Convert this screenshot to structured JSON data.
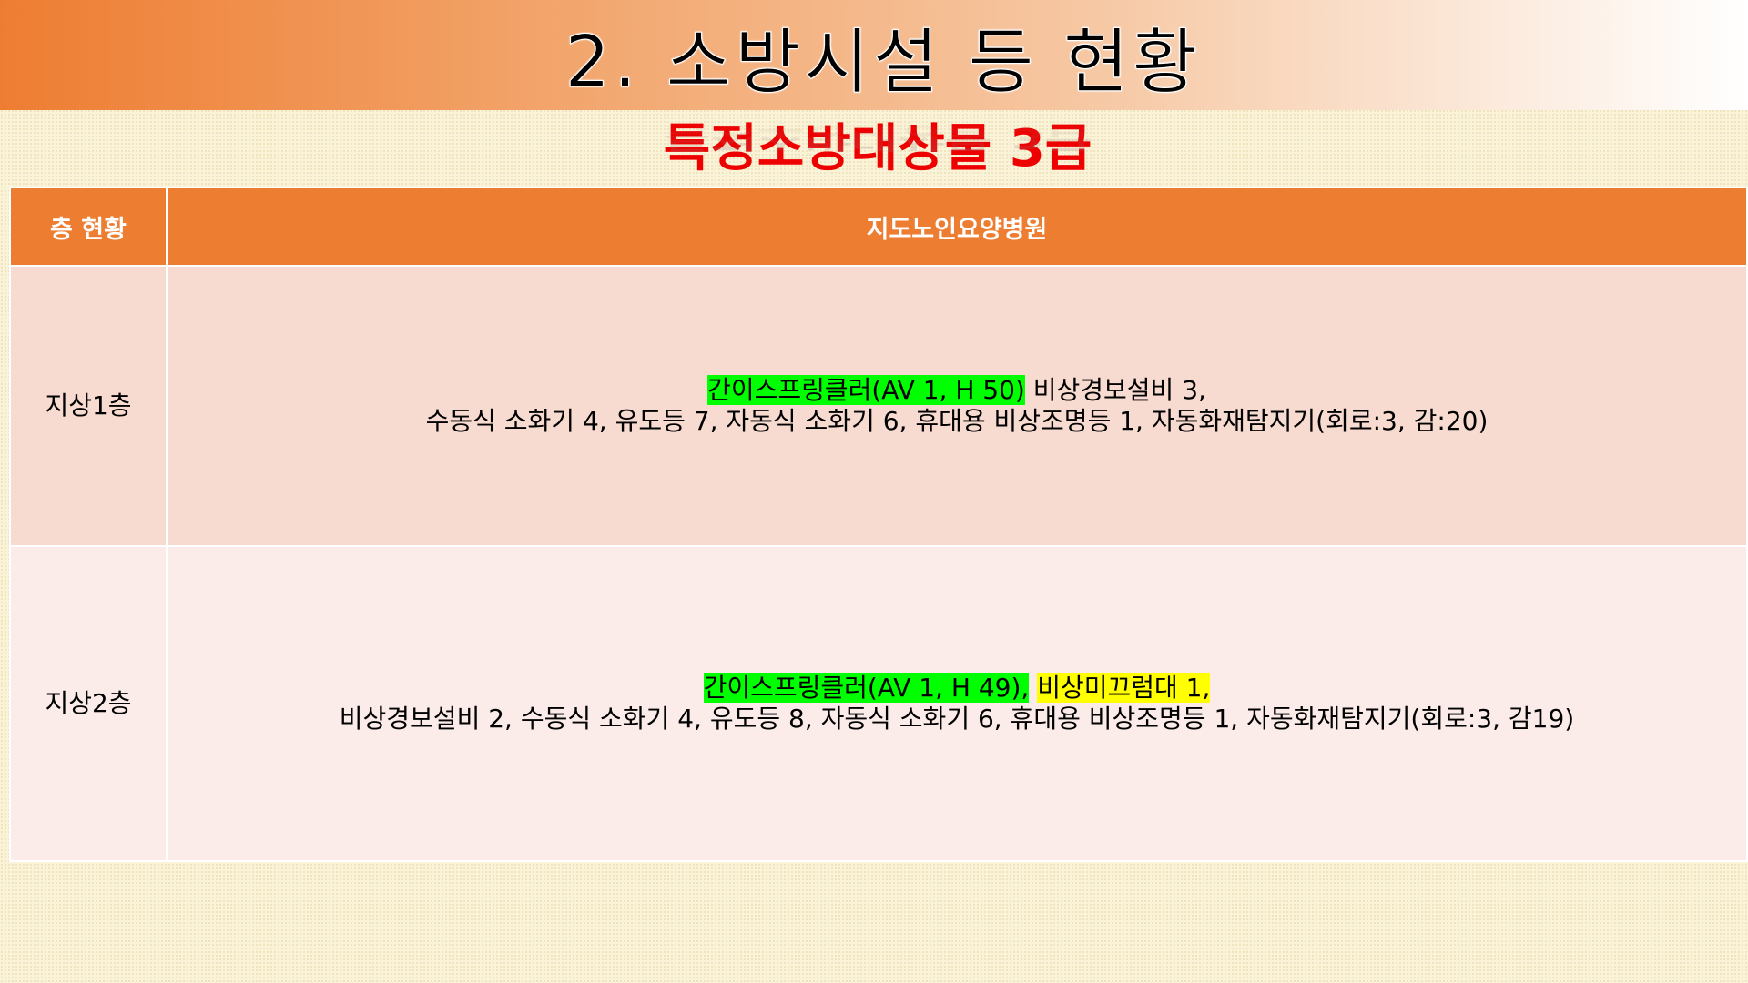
{
  "slide": {
    "title": "2. 소방시설 등 현황",
    "subtitle": "특정소방대상물 3급"
  },
  "table": {
    "headers": {
      "floor": "층 현황",
      "building": "지도노인요양병원"
    },
    "rows": [
      {
        "floor": "지상1층",
        "line1_highlight": "간이스프링클러(AV 1, H 50)",
        "line1_rest": " 비상경보설비 3,",
        "line2": "수동식 소화기 4, 유도등 7, 자동식 소화기 6, 휴대용 비상조명등 1, 자동화재탐지기(회로:3, 감:20)"
      },
      {
        "floor": "지상2층",
        "line1_highlight": "간이스프링클러(AV 1, H 49),",
        "line1_highlight2": "비상미끄럼대 1,",
        "line2": "비상경보설비 2, 수동식 소화기 4, 유도등 8, 자동식 소화기 6, 휴대용 비상조명등 1, 자동화재탐지기(회로:3, 감19)"
      }
    ]
  },
  "colors": {
    "header_orange": "#ed7d31",
    "subtitle_red": "#ee0000",
    "row1_bg": "#f8dbd0",
    "row2_bg": "#fbecea",
    "highlight_green": "#00ff00",
    "highlight_yellow": "#ffff00"
  }
}
